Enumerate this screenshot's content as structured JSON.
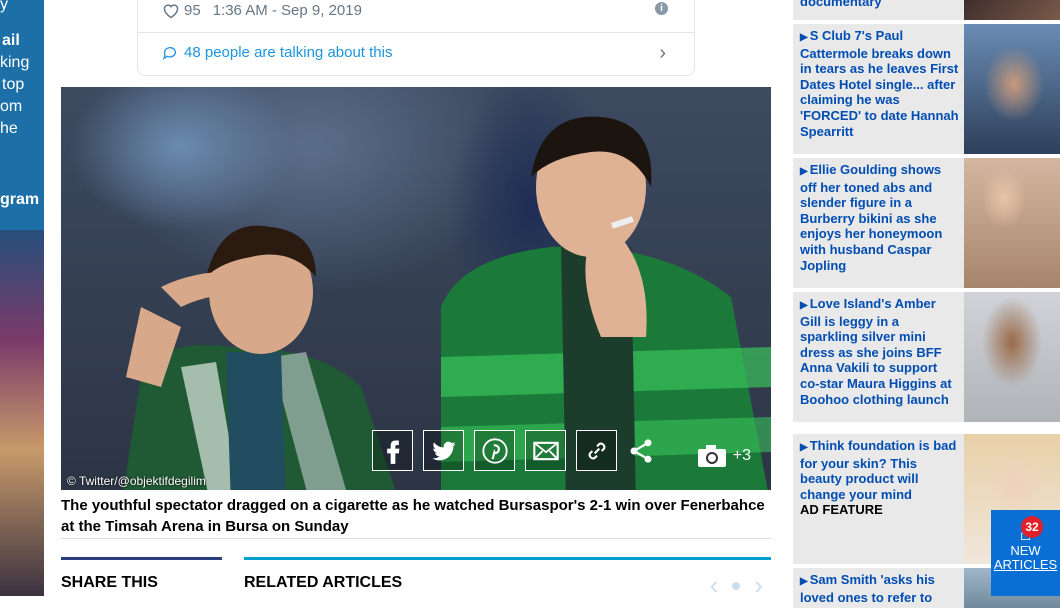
{
  "left_ad": {
    "lines": [
      "y",
      "ail",
      "king",
      "top",
      "om",
      "he",
      "gram"
    ]
  },
  "tweet": {
    "likes": "95",
    "time": "1:36 AM - Sep 9, 2019",
    "talking": "48 people are talking about this"
  },
  "photo": {
    "credit": "© Twitter/@objektifdegilim",
    "gallery_count": "+3",
    "share_buttons": [
      "facebook-icon",
      "twitter-icon",
      "pinterest-icon",
      "email-icon",
      "link-icon",
      "share-icon"
    ]
  },
  "caption": "The youthful spectator dragged on a cigarette as he watched Bursaspor's 2-1 win over Fenerbahce at the Timsah Arena in Bursa on Sunday",
  "share_this": "SHARE THIS",
  "related": "RELATED ARTICLES",
  "sidebar": {
    "stories": [
      {
        "title": "documentary",
        "ad": ""
      },
      {
        "title": "S Club 7's Paul Cattermole breaks down in tears as he leaves First Dates Hotel single... after claiming he was 'FORCED' to date Hannah Spearritt",
        "ad": ""
      },
      {
        "title": "Ellie Goulding shows off her toned abs and slender figure in a Burberry bikini as she enjoys her honeymoon with husband Caspar Jopling",
        "ad": ""
      },
      {
        "title": "Love Island's Amber Gill is leggy in a sparkling silver mini dress as she joins BFF Anna Vakili to support co-star Maura Higgins at Boohoo clothing launch",
        "ad": ""
      },
      {
        "title": "Think foundation is bad for your skin? This beauty product will change your mind",
        "ad": "AD FEATURE"
      },
      {
        "title": "Sam Smith 'asks his loved ones to refer to",
        "ad": ""
      }
    ]
  },
  "new_articles": {
    "count": "32",
    "label1": "NEW",
    "label2": "ARTICLES"
  }
}
